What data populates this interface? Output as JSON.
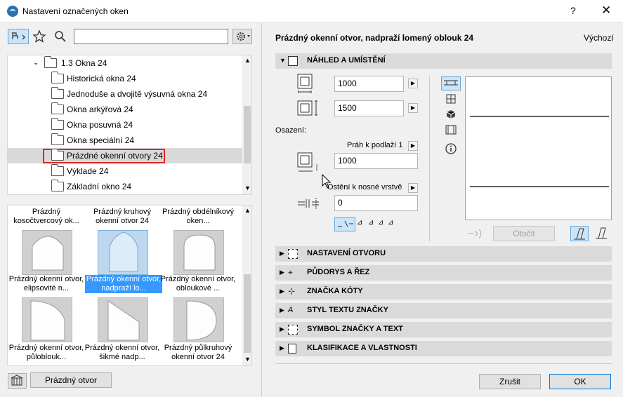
{
  "window": {
    "title": "Nastavení označených oken",
    "help": "?",
    "close": "✕"
  },
  "left": {
    "search": {
      "value": "",
      "placeholder": ""
    },
    "tree": {
      "items": [
        {
          "label": "1.3 Okna 24",
          "expanded": true
        },
        {
          "label": "Historická okna 24"
        },
        {
          "label": "Jednoduše a dvojitě výsuvná okna 24"
        },
        {
          "label": "Okna arkýřová 24"
        },
        {
          "label": "Okna posuvná 24"
        },
        {
          "label": "Okna speciální 24"
        },
        {
          "label": "Prázdné okenní otvory 24",
          "selected": true
        },
        {
          "label": "Výklade 24"
        },
        {
          "label": "Základní okno 24"
        }
      ]
    },
    "gallery": {
      "top_labels": [
        "Prázdný kosočtvercový ok...",
        "Prázdný kruhový okenní otvor 24",
        "Prázdný obdélníkový oken..."
      ],
      "row1": [
        "Prázdný okenní otvor, elipsovité n...",
        "Prázdný okenní otvor, nadpraží lo...",
        "Prázdný okenní otvor, obloukové ..."
      ],
      "row2": [
        "Prázdný okenní otvor, půloblouk...",
        "Prázdný okenní otvor, šikmé nadp...",
        "Prázdný půlkruhový okenní otvor 24"
      ]
    },
    "bottom_button": "Prázdný otvor"
  },
  "right": {
    "object_title": "Prázdný okenní otvor, nadpraží lomený oblouk 24",
    "default_label": "Výchozí",
    "sections": {
      "preview": "NÁHLED A UMÍSTĚNÍ",
      "opening": "NASTAVENÍ OTVORU",
      "plan": "PŮDORYS A ŘEZ",
      "dim": "ZNAČKA KÓTY",
      "text": "STYL TEXTU ZNAČKY",
      "symbol": "SYMBOL ZNAČKY A TEXT",
      "class": "KLASIFIKACE A VLASTNOSTI"
    },
    "width_value": "1000",
    "height_value": "1500",
    "placement_label": "Osazení:",
    "sill_label": "Práh k podlaží 1",
    "sill_value": "1000",
    "reveal_label": "Ostění k nosné vrstvě",
    "reveal_value": "0",
    "rotate_button": "Otočit"
  },
  "footer": {
    "cancel": "Zrušit",
    "ok": "OK"
  }
}
